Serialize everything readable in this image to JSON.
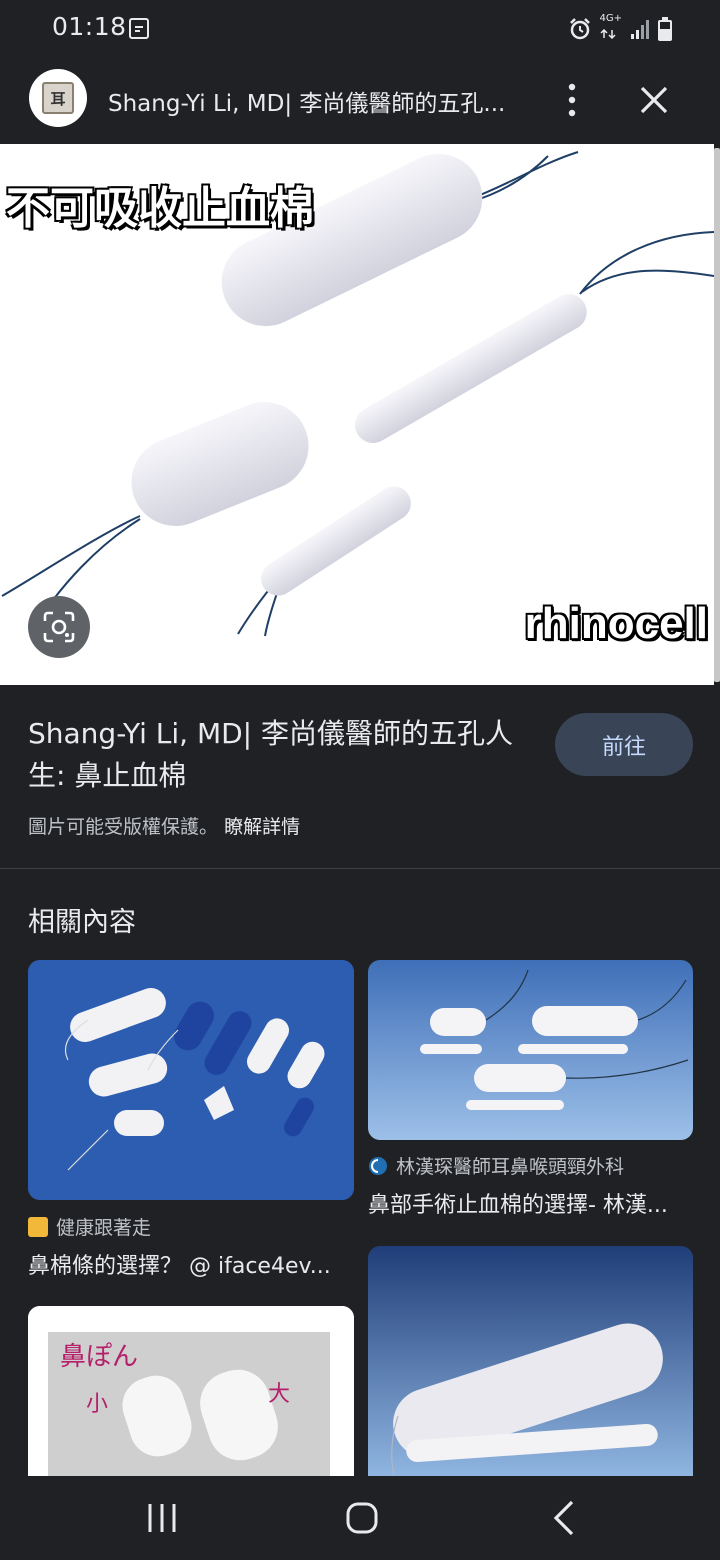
{
  "status_bar": {
    "time": "01:18",
    "network": "4G+"
  },
  "header": {
    "title": "Shang-Yi Li, MD| 李尚儀醫師的五孔...",
    "favicon_glyph": "耳"
  },
  "hero": {
    "caption": "不可吸收止血棉",
    "brand": "rhinocell"
  },
  "info": {
    "title": "Shang-Yi Li, MD| 李尚儀醫師的五孔人生: 鼻止血棉",
    "visit_label": "前往",
    "copyright": "圖片可能受版權保護。",
    "learn_more": "瞭解詳情"
  },
  "related": {
    "heading": "相關內容",
    "cards": [
      {
        "source": "健康跟著走",
        "title": "鼻棉條的選擇？ @ iface4ev..."
      },
      {
        "source": "林漢琛醫師耳鼻喉頭頸外科",
        "title": "鼻部手術止血棉的選擇- 林漢..."
      },
      {
        "image_text_1": "鼻ぽん",
        "image_text_2": "小",
        "image_text_3": "大"
      }
    ]
  },
  "colors": {
    "background": "#202124",
    "visit_button": "#394457",
    "lens_button": "#5f6368"
  }
}
